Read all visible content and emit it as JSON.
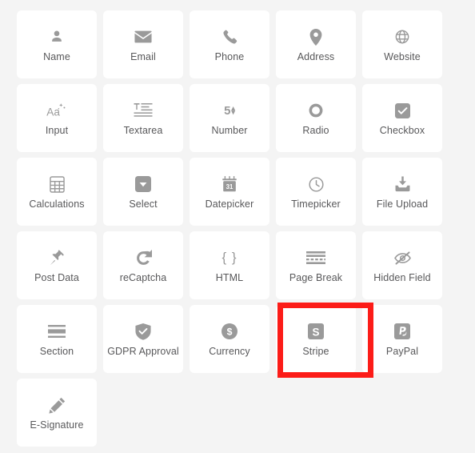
{
  "palette": {
    "background_color": "#f4f4f4",
    "card_color": "#ffffff",
    "icon_color": "#9a9a9a",
    "label_color": "#58585a",
    "highlight_color": "#fc1c18",
    "highlighted_item": "Stripe",
    "items": [
      {
        "label": "Name",
        "icon": "user-icon"
      },
      {
        "label": "Email",
        "icon": "envelope-icon"
      },
      {
        "label": "Phone",
        "icon": "phone-icon"
      },
      {
        "label": "Address",
        "icon": "map-pin-icon"
      },
      {
        "label": "Website",
        "icon": "globe-icon"
      },
      {
        "label": "Input",
        "icon": "text-input-icon"
      },
      {
        "label": "Textarea",
        "icon": "text-lines-icon"
      },
      {
        "label": "Number",
        "icon": "number-spinner-icon"
      },
      {
        "label": "Radio",
        "icon": "radio-circle-icon"
      },
      {
        "label": "Checkbox",
        "icon": "checkbox-icon"
      },
      {
        "label": "Calculations",
        "icon": "calculator-icon"
      },
      {
        "label": "Select",
        "icon": "dropdown-icon"
      },
      {
        "label": "Datepicker",
        "icon": "calendar-icon"
      },
      {
        "label": "Timepicker",
        "icon": "clock-icon"
      },
      {
        "label": "File Upload",
        "icon": "upload-icon"
      },
      {
        "label": "Post Data",
        "icon": "pin-icon"
      },
      {
        "label": "reCaptcha",
        "icon": "refresh-icon"
      },
      {
        "label": "HTML",
        "icon": "curly-braces-icon"
      },
      {
        "label": "Page Break",
        "icon": "page-break-icon"
      },
      {
        "label": "Hidden Field",
        "icon": "eye-off-icon"
      },
      {
        "label": "Section",
        "icon": "section-lines-icon"
      },
      {
        "label": "GDPR Approval",
        "icon": "shield-check-icon"
      },
      {
        "label": "Currency",
        "icon": "dollar-coin-icon"
      },
      {
        "label": "Stripe",
        "icon": "stripe-icon"
      },
      {
        "label": "PayPal",
        "icon": "paypal-icon"
      },
      {
        "label": "E-Signature",
        "icon": "pencil-icon"
      }
    ]
  },
  "icon_glyphs": {
    "number_value": "5",
    "number_up": "▴",
    "number_down": "▾",
    "braces": "{ }",
    "checkbox_check": "✓",
    "stripe_letter": "S",
    "paypal_letter": "P",
    "calendar_day": "31"
  }
}
